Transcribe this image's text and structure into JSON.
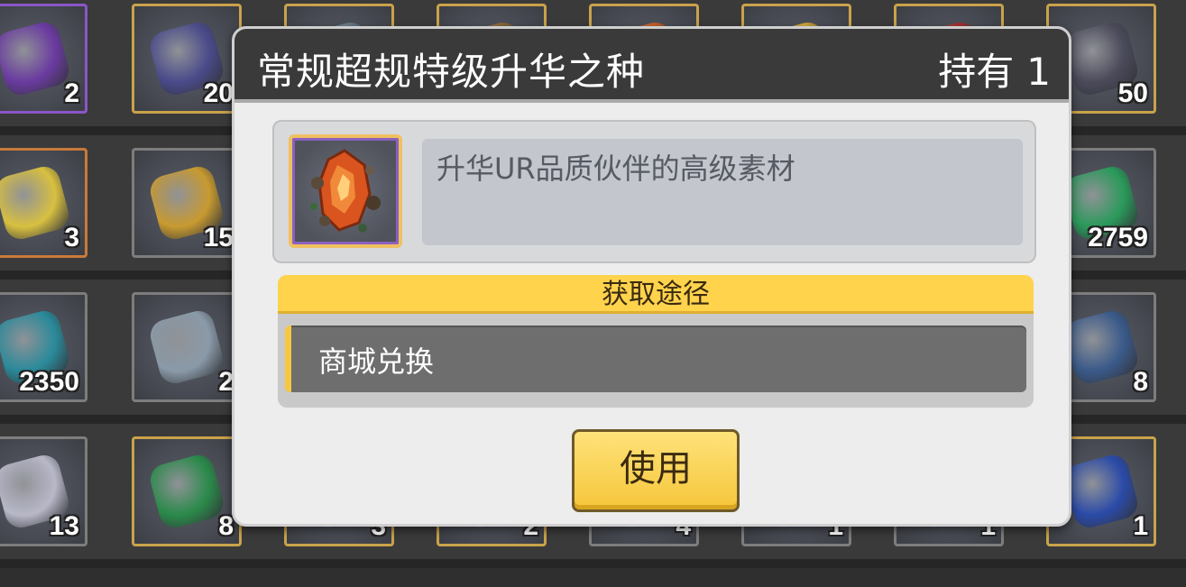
{
  "dialog": {
    "title": "常规超规特级升华之种",
    "owned_label": "持有",
    "owned_count": "1",
    "item_description": "升华UR品质伙伴的高级素材",
    "item_icon": "orange-crystal-seed-icon",
    "source_section_title": "获取途径",
    "source_items": [
      {
        "label": "商城兑换"
      }
    ],
    "use_button_label": "使用"
  },
  "inventory": {
    "rows": [
      {
        "slots": [
          {
            "icon": "shadow-creature-icon",
            "count": "2",
            "tier": "purple",
            "color": "#6a3aa0"
          },
          {
            "icon": "dark-wing-icon",
            "count": "20",
            "tier": "gold",
            "color": "#4a4a8a"
          },
          {
            "icon": "item-icon",
            "count": "",
            "tier": "gold",
            "color": "#6a7b8c"
          },
          {
            "icon": "potion-bottle-icon",
            "count": "",
            "tier": "gold",
            "color": "#8a6a3a"
          },
          {
            "icon": "orange-item-icon",
            "count": "",
            "tier": "gold",
            "color": "#c8602a"
          },
          {
            "icon": "gold-coin-icon",
            "count": "",
            "tier": "gold",
            "color": "#d4a83a"
          },
          {
            "icon": "red-flower-icon",
            "count": "",
            "tier": "gold",
            "color": "#a83030"
          },
          {
            "icon": "dark-geode-icon",
            "count": "50",
            "tier": "gold",
            "color": "#4a4a5a"
          }
        ]
      },
      {
        "slots": [
          {
            "icon": "test-tube-icon",
            "count": "3",
            "tier": "orange",
            "color": "#d8c040"
          },
          {
            "icon": "gold-coin-icon",
            "count": "15",
            "tier": "",
            "color": "#c89a30"
          },
          {
            "icon": "",
            "count": "",
            "tier": "",
            "color": ""
          },
          {
            "icon": "",
            "count": "",
            "tier": "",
            "color": ""
          },
          {
            "icon": "",
            "count": "",
            "tier": "",
            "color": ""
          },
          {
            "icon": "",
            "count": "",
            "tier": "",
            "color": ""
          },
          {
            "icon": "",
            "count": "",
            "tier": "",
            "color": ""
          },
          {
            "icon": "green-jade-icon",
            "count": "2759",
            "tier": "",
            "color": "#2a9a5a"
          }
        ]
      },
      {
        "slots": [
          {
            "icon": "teal-ore-icon",
            "count": "2350",
            "tier": "",
            "color": "#2a8a9a"
          },
          {
            "icon": "glass-jar-icon",
            "count": "2",
            "tier": "",
            "color": "#8a9aa8"
          },
          {
            "icon": "",
            "count": "",
            "tier": "",
            "color": ""
          },
          {
            "icon": "",
            "count": "",
            "tier": "",
            "color": ""
          },
          {
            "icon": "",
            "count": "",
            "tier": "",
            "color": ""
          },
          {
            "icon": "",
            "count": "",
            "tier": "",
            "color": ""
          },
          {
            "icon": "",
            "count": "",
            "tier": "",
            "color": ""
          },
          {
            "icon": "lantern-cube-icon",
            "count": "8",
            "tier": "",
            "color": "#3a5a8a"
          }
        ]
      },
      {
        "slots": [
          {
            "icon": "silver-ore-icon",
            "count": "13",
            "tier": "",
            "color": "#b8b8c8"
          },
          {
            "icon": "green-crystal-icon",
            "count": "8",
            "tier": "gold",
            "color": "#2a8a4a"
          },
          {
            "icon": "item-icon",
            "count": "3",
            "tier": "gold",
            "color": "#6a7b8c"
          },
          {
            "icon": "item-icon",
            "count": "2",
            "tier": "gold",
            "color": "#6a7b8c"
          },
          {
            "icon": "item-icon",
            "count": "4",
            "tier": "",
            "color": "#6a7b8c"
          },
          {
            "icon": "item-icon",
            "count": "1",
            "tier": "",
            "color": "#6a7b8c"
          },
          {
            "icon": "item-icon",
            "count": "1",
            "tier": "",
            "color": "#6a7b8c"
          },
          {
            "icon": "blue-claw-icon",
            "count": "1",
            "tier": "gold",
            "color": "#2a4aa8"
          }
        ]
      }
    ]
  }
}
